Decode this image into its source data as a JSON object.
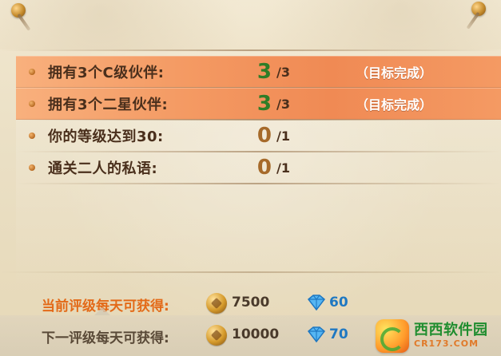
{
  "achievements": {
    "rows": [
      {
        "label": "拥有3个C级伙伴:",
        "value": "3",
        "total": "/3",
        "status": "（目标完成）",
        "value_color": "#2f7d27",
        "highlight": true
      },
      {
        "label": "拥有3个二星伙伴:",
        "value": "3",
        "total": "/3",
        "status": "（目标完成）",
        "value_color": "#2f7d27",
        "highlight": true
      },
      {
        "label": "你的等级达到30:",
        "value": "0",
        "total": "/1",
        "status": "",
        "value_color": "#a66a2a",
        "highlight": false
      },
      {
        "label": "通关二人的私语:",
        "value": "0",
        "total": "/1",
        "status": "",
        "value_color": "#a66a2a",
        "highlight": false
      }
    ]
  },
  "rewards": {
    "current": {
      "title": "当前评级每天可获得:",
      "coins": "7500",
      "gems": "60"
    },
    "next": {
      "title": "下一评级每天可获得:",
      "coins": "10000",
      "gems": "70"
    }
  },
  "watermark": {
    "cn": "西西软件园",
    "en": "CR173.COM",
    "logo_text": "C"
  },
  "colors": {
    "highlight": "#f49a63",
    "green": "#2f7d27",
    "brown": "#a66a2a",
    "gem_blue": "#1f78c2",
    "current_title": "#e36a18"
  }
}
